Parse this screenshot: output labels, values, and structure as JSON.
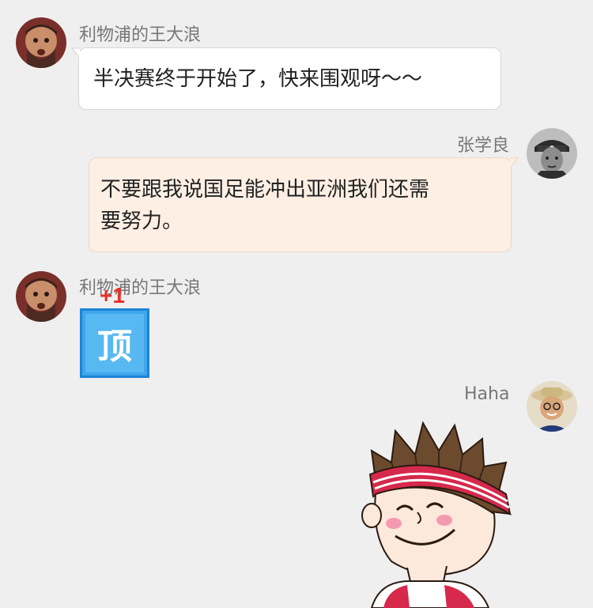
{
  "messages": [
    {
      "sender": "利物浦的王大浪",
      "text": "半决赛终于开始了，快来围观呀～～"
    },
    {
      "sender": "张学良",
      "text_line1": "不要跟我说国足能冲出亚洲我们还需",
      "text_line2": "要努力。"
    },
    {
      "sender": "利物浦的王大浪",
      "sticker_text": "顶",
      "sticker_badge": "+1"
    },
    {
      "sender": "Haha"
    }
  ],
  "colors": {
    "background": "#efefef",
    "bubble_left": "#ffffff",
    "bubble_right": "#fdefe4",
    "sticker_blue": "#3ea6ea",
    "badge_red": "#e5322b"
  }
}
